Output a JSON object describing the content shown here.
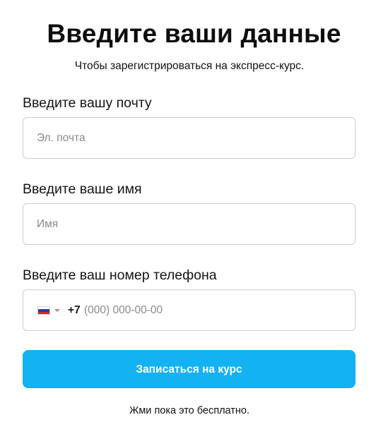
{
  "header": {
    "title": "Введите ваши данные",
    "subtitle": "Чтобы зарегистрироваться на экспресс-курс."
  },
  "form": {
    "email": {
      "label": "Введите вашу почту",
      "placeholder": "Эл. почта",
      "value": ""
    },
    "name": {
      "label": "Введите ваше имя",
      "placeholder": "Имя",
      "value": ""
    },
    "phone": {
      "label": "Введите ваш номер телефона",
      "country_icon": "russia-flag-icon",
      "dial_code": "+7",
      "placeholder": "(000) 000-00-00",
      "value": ""
    },
    "submit_label": "Записаться на курс",
    "footnote": "Жми пока это бесплатно."
  },
  "colors": {
    "accent": "#13b2f2",
    "border": "#cfcfcf",
    "text": "#111111",
    "placeholder": "#8a8a8a"
  }
}
